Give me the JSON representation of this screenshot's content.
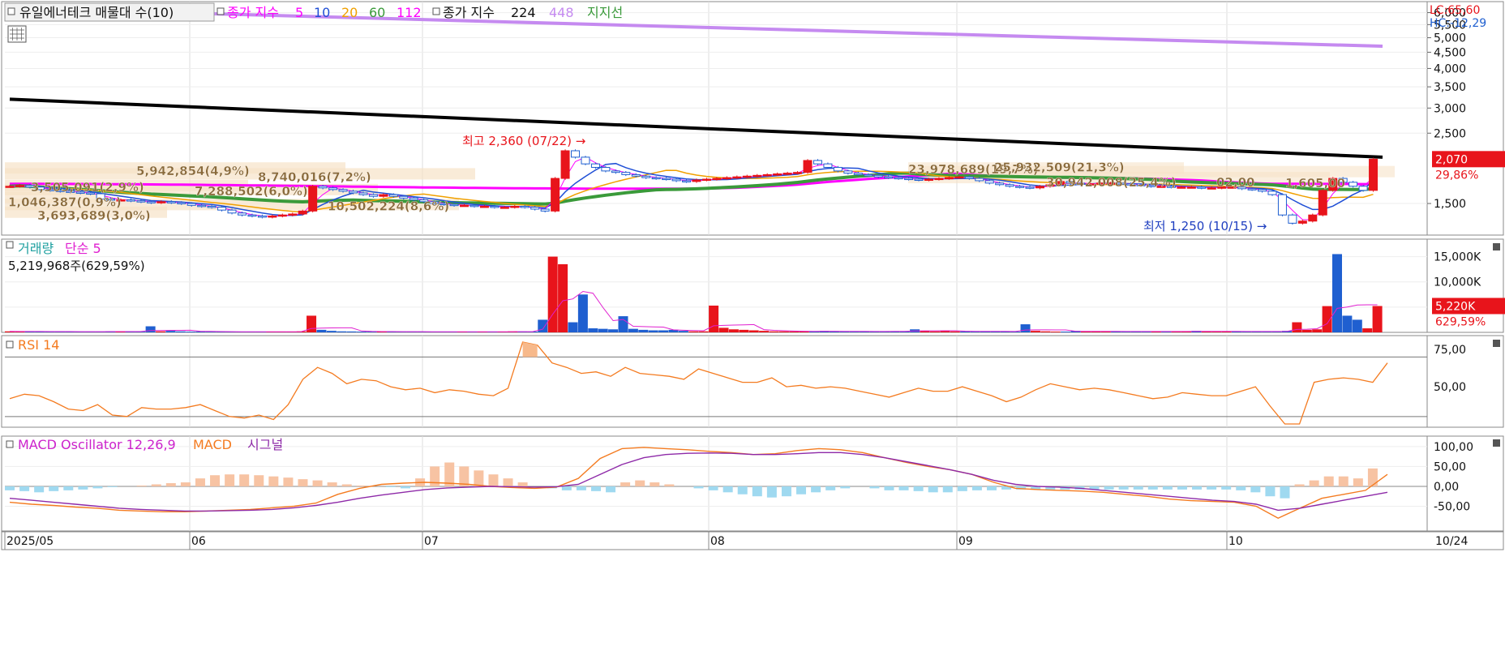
{
  "price_panel": {
    "title": "유일에너테크 매물대 수(10)",
    "ma_prefix": "종가 지수",
    "ma_periods": [
      {
        "label": "5",
        "color": "#ff00ff"
      },
      {
        "label": "10",
        "color": "#1f4fd6"
      },
      {
        "label": "20",
        "color": "#f0a000"
      },
      {
        "label": "60",
        "color": "#3a9a3a"
      },
      {
        "label": "112",
        "color": "#ff00ff"
      }
    ],
    "ma_long_prefix": "종가 지수",
    "ma_long_periods": [
      {
        "label": "224",
        "color": "#000000"
      },
      {
        "label": "448",
        "color": "#c58af0"
      }
    ],
    "support_label": "지지선",
    "lc_label": "LC:65,60",
    "hc_label": "HC:-12,29",
    "high_annotation": "최고 2,360 (07/22)",
    "low_annotation": "최저 1,250 (10/15)",
    "last_price": "2,070",
    "last_change": "29,86%",
    "axis_ticks": [
      "6,000",
      "5,500",
      "5,000",
      "4,500",
      "4,000",
      "3,500",
      "3,000",
      "2,500",
      "1,500"
    ],
    "profile_labels": [
      "5,942,854(4,9%)",
      "8,740,016(7,2%)",
      "3,505,091(2,9%)",
      "7,288,502(6,0%)",
      "1,046,387(0,9%)",
      "10,502,224(8,6%)",
      "3,693,689(3,0%)",
      "23,978,689(19,7%)",
      "25,932,509(21,3%)",
      "30,942,008(25,4%)",
      "02,00",
      "1,605,00"
    ]
  },
  "volume_panel": {
    "title": "거래량",
    "ma_label": "단순 5",
    "summary": "5,219,968주(629,59%)",
    "axis_ticks": [
      "15,000K",
      "10,000K",
      "5,000K"
    ],
    "last_value": "5,220K",
    "last_change": "629,59%"
  },
  "rsi_panel": {
    "title": "RSI 14",
    "axis_ticks": [
      "75,00",
      "50,00"
    ]
  },
  "macd_panel": {
    "title": "MACD Oscillator 12,26,9",
    "macd_label": "MACD",
    "signal_label": "시그널",
    "axis_ticks": [
      "100,00",
      "50,00",
      "0,00",
      "-50,00"
    ]
  },
  "x_axis": {
    "labels": [
      "2025/05",
      "06",
      "07",
      "08",
      "09",
      "10"
    ],
    "last_label": "10/24"
  },
  "colors": {
    "up": "#e8141b",
    "down": "#1f5fd0",
    "ma5": "#ff00ff",
    "ma10": "#1f4fd6",
    "ma20": "#f0a000",
    "ma60": "#3a9a3a",
    "ma224": "#000000",
    "ma448": "#c58af0",
    "rsi": "#f47b20",
    "macd": "#f47b20",
    "signal": "#8e2aa8",
    "osc_pos": "#f7c3a3",
    "osc_neg": "#9fd9f0"
  },
  "chart_data": [
    {
      "type": "candlestick",
      "title": "유일에너테크 매물대 수(10)",
      "x_months": [
        "2025/05",
        "06",
        "07",
        "08",
        "09",
        "10"
      ],
      "y_range": [
        1250,
        6200
      ],
      "high": {
        "price": 2360,
        "date": "07/22"
      },
      "low": {
        "price": 1250,
        "date": "10/15"
      },
      "close": [
        1700,
        1710,
        1690,
        1660,
        1650,
        1640,
        1630,
        1620,
        1610,
        1550,
        1540,
        1540,
        1530,
        1520,
        1510,
        1520,
        1510,
        1500,
        1480,
        1470,
        1460,
        1430,
        1400,
        1380,
        1370,
        1360,
        1370,
        1380,
        1390,
        1420,
        1700,
        1680,
        1660,
        1640,
        1620,
        1600,
        1580,
        1600,
        1580,
        1560,
        1540,
        1520,
        1500,
        1490,
        1480,
        1480,
        1470,
        1470,
        1460,
        1460,
        1470,
        1460,
        1440,
        1420,
        1800,
        2200,
        2100,
        2000,
        1950,
        1900,
        1880,
        1850,
        1830,
        1810,
        1800,
        1790,
        1770,
        1760,
        1780,
        1790,
        1800,
        1810,
        1820,
        1830,
        1840,
        1850,
        1860,
        1870,
        1880,
        2050,
        2000,
        1950,
        1900,
        1870,
        1850,
        1840,
        1820,
        1810,
        1800,
        1790,
        1780,
        1790,
        1800,
        1810,
        1820,
        1800,
        1770,
        1740,
        1720,
        1700,
        1690,
        1680,
        1700,
        1720,
        1760,
        1740,
        1730,
        1730,
        1740,
        1740,
        1730,
        1720,
        1710,
        1700,
        1700,
        1690,
        1690,
        1690,
        1680,
        1680,
        1690,
        1690,
        1670,
        1660,
        1640,
        1600,
        1380,
        1300,
        1320,
        1380,
        1650,
        1800,
        1750,
        1700,
        1650,
        2070
      ],
      "ma224": [
        3200,
        2100
      ],
      "ma448": [
        6200,
        4700
      ],
      "profile_volumes": [
        "5,942,854(4,9%)",
        "8,740,016(7,2%)",
        "3,505,091(2,9%)",
        "7,288,502(6,0%)",
        "1,046,387(0,9%)",
        "10,502,224(8,6%)",
        "3,693,689(3,0%)",
        "23,978,689(19,7%)",
        "25,932,509(21,3%)",
        "30,942,008(25,4%)"
      ]
    },
    {
      "type": "bar",
      "title": "거래량",
      "unit": "K",
      "values": [
        200,
        150,
        180,
        160,
        150,
        170,
        140,
        130,
        160,
        150,
        200,
        180,
        150,
        140,
        1200,
        200,
        300,
        200,
        150,
        180,
        140,
        130,
        120,
        110,
        120,
        100,
        110,
        130,
        150,
        200,
        3300,
        500,
        300,
        200,
        180,
        150,
        140,
        160,
        150,
        140,
        130,
        120,
        110,
        100,
        130,
        150,
        140,
        120,
        110,
        100,
        200,
        180,
        160,
        2500,
        15000,
        13500,
        2000,
        7500,
        800,
        700,
        600,
        3200,
        700,
        500,
        400,
        400,
        500,
        300,
        200,
        200,
        5300,
        900,
        600,
        500,
        400,
        300,
        200,
        200,
        200,
        200,
        200,
        300,
        200,
        150,
        150,
        200,
        200,
        200,
        200,
        200,
        600,
        300,
        200,
        300,
        200,
        200,
        150,
        200,
        200,
        200,
        150,
        1600,
        300,
        200,
        150,
        150,
        300,
        200,
        200,
        150,
        200,
        150,
        200,
        150,
        200,
        150,
        150,
        200,
        300,
        200,
        150,
        200,
        200,
        150,
        200,
        150,
        200,
        300,
        2000,
        500,
        600,
        5200,
        15500,
        3300,
        2500,
        800,
        5220
      ],
      "y_ticks": [
        "15,000K",
        "10,000K",
        "5,000K"
      ],
      "last": "5,220K",
      "last_change": "629,59%"
    },
    {
      "type": "line",
      "title": "RSI 14",
      "y_range": [
        25,
        80
      ],
      "values": [
        42,
        45,
        44,
        40,
        35,
        34,
        38,
        31,
        30,
        36,
        35,
        35,
        36,
        38,
        34,
        30,
        29,
        31,
        28,
        38,
        55,
        63,
        59,
        52,
        55,
        54,
        50,
        48,
        49,
        46,
        48,
        47,
        45,
        44,
        49,
        80,
        78,
        66,
        63,
        59,
        60,
        57,
        63,
        59,
        58,
        57,
        55,
        62,
        59,
        56,
        53,
        53,
        56,
        50,
        51,
        49,
        50,
        49,
        47,
        45,
        43,
        46,
        49,
        47,
        47,
        50,
        47,
        44,
        40,
        43,
        48,
        52,
        50,
        48,
        49,
        48,
        46,
        44,
        42,
        43,
        46,
        45,
        44,
        44,
        47,
        50,
        37,
        25,
        25,
        53,
        55,
        56,
        55,
        53,
        66
      ],
      "y_ticks": [
        "75,00",
        "50,00"
      ]
    },
    {
      "type": "line",
      "title": "MACD Oscillator 12,26,9",
      "series": [
        {
          "name": "MACD",
          "values": [
            -40,
            -45,
            -48,
            -52,
            -55,
            -60,
            -62,
            -64,
            -64,
            -62,
            -60,
            -58,
            -54,
            -50,
            -42,
            -20,
            -5,
            5,
            8,
            10,
            8,
            5,
            0,
            -3,
            -5,
            -2,
            20,
            70,
            95,
            98,
            95,
            92,
            88,
            85,
            80,
            82,
            90,
            95,
            92,
            85,
            72,
            60,
            50,
            42,
            30,
            10,
            -5,
            -8,
            -10,
            -12,
            -15,
            -20,
            -25,
            -32,
            -36,
            -38,
            -40,
            -50,
            -80,
            -55,
            -30,
            -20,
            -10,
            30
          ]
        },
        {
          "name": "시그널",
          "values": [
            -30,
            -35,
            -40,
            -45,
            -50,
            -55,
            -58,
            -60,
            -62,
            -62,
            -61,
            -60,
            -58,
            -54,
            -48,
            -40,
            -30,
            -22,
            -15,
            -8,
            -4,
            -2,
            0,
            -1,
            -2,
            -1,
            5,
            30,
            55,
            72,
            80,
            83,
            84,
            83,
            80,
            80,
            82,
            85,
            85,
            80,
            72,
            62,
            52,
            42,
            30,
            15,
            5,
            0,
            -2,
            -5,
            -10,
            -15,
            -20,
            -25,
            -30,
            -35,
            -38,
            -45,
            -60,
            -55,
            -45,
            -35,
            -25,
            -15
          ]
        }
      ],
      "oscillator": [
        -10,
        -12,
        -15,
        -12,
        -10,
        -8,
        -5,
        -2,
        0,
        2,
        5,
        8,
        10,
        20,
        28,
        30,
        30,
        28,
        25,
        22,
        18,
        15,
        10,
        5,
        2,
        0,
        -2,
        -5,
        20,
        50,
        60,
        50,
        40,
        30,
        20,
        10,
        0,
        -5,
        -10,
        -10,
        -12,
        -15,
        10,
        15,
        10,
        5,
        0,
        -5,
        -10,
        -15,
        -20,
        -25,
        -28,
        -25,
        -20,
        -15,
        -10,
        -5,
        0,
        -5,
        -10,
        -10,
        -12,
        -15,
        -15,
        -12,
        -10,
        -10,
        -8,
        -8,
        -8,
        -8,
        -8,
        -8,
        -8,
        -8,
        -8,
        -8,
        -8,
        -8,
        -8,
        -8,
        -8,
        -8,
        -10,
        -15,
        -25,
        -30,
        5,
        15,
        25,
        25,
        20,
        45
      ],
      "y_range": [
        -100,
        110
      ],
      "y_ticks": [
        "100,00",
        "50,00",
        "0,00",
        "-50,00"
      ]
    }
  ]
}
